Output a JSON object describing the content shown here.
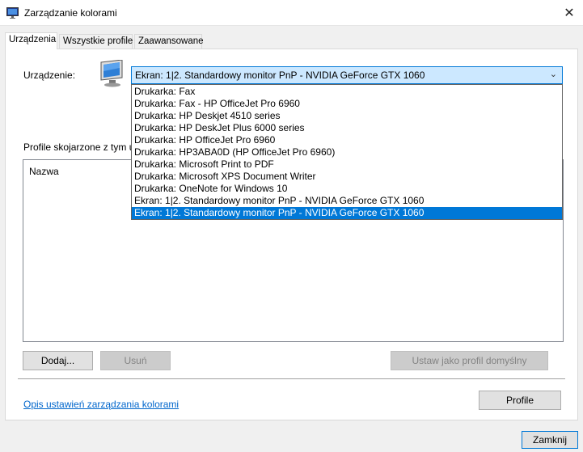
{
  "window": {
    "title": "Zarządzanie kolorami",
    "close_glyph": "✕"
  },
  "tabs": [
    {
      "label": "Urządzenia",
      "active": true
    },
    {
      "label": "Wszystkie profile",
      "active": false
    },
    {
      "label": "Zaawansowane",
      "active": false
    }
  ],
  "device": {
    "label": "Urządzenie:",
    "selected": "Ekran: 1|2. Standardowy monitor PnP - NVIDIA GeForce GTX 1060",
    "arrow": "⌄",
    "options": [
      "Drukarka: Fax",
      "Drukarka: Fax - HP OfficeJet Pro 6960",
      "Drukarka: HP Deskjet 4510 series",
      "Drukarka: HP DeskJet Plus 6000 series",
      "Drukarka: HP OfficeJet Pro 6960",
      "Drukarka: HP3ABA0D (HP OfficeJet Pro 6960)",
      "Drukarka: Microsoft Print to PDF",
      "Drukarka: Microsoft XPS Document Writer",
      "Drukarka: OneNote for Windows 10",
      "Ekran: 1|2. Standardowy monitor PnP - NVIDIA GeForce GTX 1060",
      "Ekran: 1|2. Standardowy monitor PnP - NVIDIA GeForce GTX 1060"
    ],
    "highlighted_index": 10
  },
  "profiles": {
    "label": "Profile skojarzone z tym u",
    "column_header": "Nazwa"
  },
  "buttons": {
    "add": "Dodaj...",
    "remove": "Usuń",
    "set_default": "Ustaw jako profil domyślny",
    "profile": "Profile",
    "close": "Zamknij"
  },
  "link": {
    "text": "Opis ustawień zarządzania kolorami"
  },
  "colors": {
    "accent": "#0078d7",
    "selection_bg": "#cce8ff",
    "link": "#0066cc"
  }
}
